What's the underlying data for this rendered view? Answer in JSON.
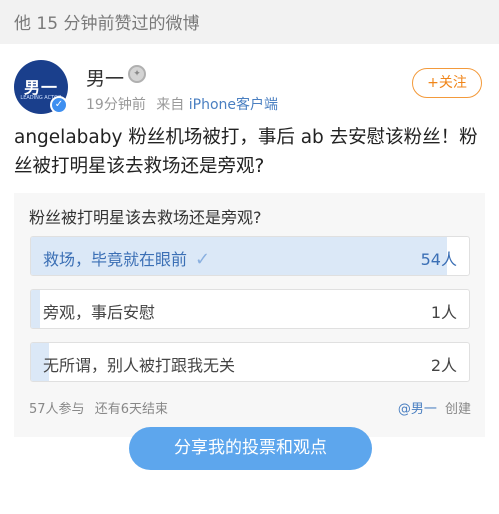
{
  "header": {
    "title": "他 15 分钟前赞过的微博"
  },
  "post": {
    "username": "男一",
    "avatar_text": "男一",
    "avatar_subtext": "LEADING ACTOR",
    "time": "19分钟前",
    "source_prefix": "来自",
    "source": "iPhone客户端",
    "follow_label": "+关注",
    "text": "angelababy 粉丝机场被打，事后 ab 去安慰该粉丝！粉丝被打明星该去救场还是旁观?"
  },
  "poll": {
    "question": "粉丝被打明星该去救场还是旁观?",
    "options": [
      {
        "label": "救场，毕竟就在眼前",
        "count": "54人",
        "fraction": 0.95,
        "voted": true
      },
      {
        "label": "旁观，事后安慰",
        "count": "1人",
        "fraction": 0.02,
        "voted": false
      },
      {
        "label": "无所谓，别人被打跟我无关",
        "count": "2人",
        "fraction": 0.04,
        "voted": false
      }
    ],
    "participants": "57人参与",
    "remaining": "还有6天结束",
    "creator_handle": "@男一",
    "creator_suffix": "创建",
    "share_label": "分享我的投票和观点"
  },
  "colors": {
    "accent": "#5da6ed",
    "follow": "#f08519",
    "link": "#4a7fc1"
  }
}
